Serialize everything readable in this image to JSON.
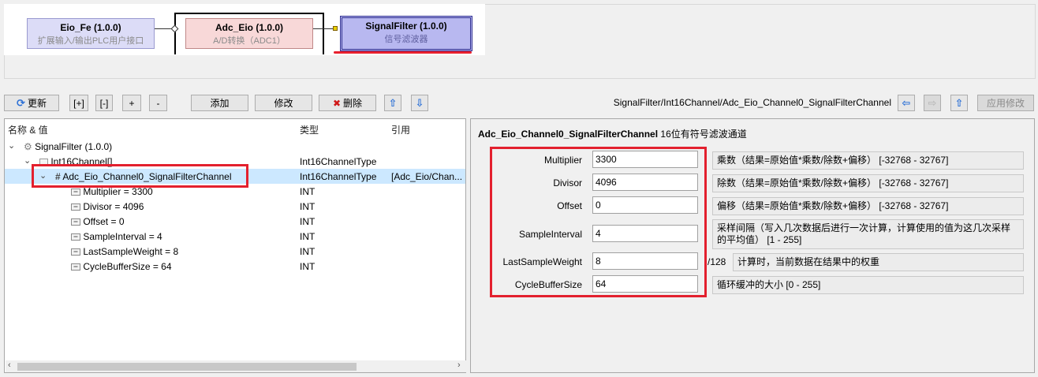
{
  "modules": [
    {
      "name": "Eio_Fe (1.0.0)",
      "desc": "扩展输入/输出PLC用户接口"
    },
    {
      "name": "Adc_Eio (1.0.0)",
      "desc": "A/D转换（ADC1）"
    },
    {
      "name": "SignalFilter (1.0.0)",
      "desc": "信号滤波器"
    }
  ],
  "toolbar": {
    "refresh": "更新",
    "expand": "[+]",
    "collapse": "[-]",
    "plus": "+",
    "minus": "-",
    "add": "添加",
    "modify": "修改",
    "delete": "删除",
    "apply": "应用修改"
  },
  "path": "SignalFilter/Int16Channel/Adc_Eio_Channel0_SignalFilterChannel",
  "tree": {
    "headers": {
      "name": "名称 & 值",
      "type": "类型",
      "ref": "引用"
    },
    "rows": [
      {
        "name": "SignalFilter (1.0.0)",
        "type": "",
        "ref": ""
      },
      {
        "name": "Int16Channel[]",
        "type": "Int16ChannelType",
        "ref": ""
      },
      {
        "name": "Adc_Eio_Channel0_SignalFilterChannel",
        "type": "Int16ChannelType",
        "ref": "[Adc_Eio/Chan..."
      },
      {
        "name": "Multiplier = 3300",
        "type": "INT",
        "ref": ""
      },
      {
        "name": "Divisor = 4096",
        "type": "INT",
        "ref": ""
      },
      {
        "name": "Offset = 0",
        "type": "INT",
        "ref": ""
      },
      {
        "name": "SampleInterval = 4",
        "type": "INT",
        "ref": ""
      },
      {
        "name": "LastSampleWeight = 8",
        "type": "INT",
        "ref": ""
      },
      {
        "name": "CycleBufferSize = 64",
        "type": "INT",
        "ref": ""
      }
    ]
  },
  "detail": {
    "title": "Adc_Eio_Channel0_SignalFilterChannel",
    "subtitle": "16位有符号滤波通道",
    "params": [
      {
        "label": "Multiplier",
        "value": "3300",
        "desc": "乘数（结果=原始值*乘数/除数+偏移） [-32768 - 32767]"
      },
      {
        "label": "Divisor",
        "value": "4096",
        "desc": "除数（结果=原始值*乘数/除数+偏移） [-32768 - 32767]"
      },
      {
        "label": "Offset",
        "value": "0",
        "desc": "偏移（结果=原始值*乘数/除数+偏移） [-32768 - 32767]"
      },
      {
        "label": "SampleInterval",
        "value": "4",
        "desc": "采样间隔（写入几次数据后进行一次计算，计算使用的值为这几次采样的平均值） [1 - 255]"
      },
      {
        "label": "LastSampleWeight",
        "value": "8",
        "suffix": "/128",
        "desc": "计算时，当前数据在结果中的权重"
      },
      {
        "label": "CycleBufferSize",
        "value": "64",
        "desc": "循环缓冲的大小 [0 - 255]"
      }
    ]
  },
  "colors": {
    "highlight": "#e3202e",
    "selection": "#cce8ff",
    "arrow": "#2a6fd6"
  }
}
